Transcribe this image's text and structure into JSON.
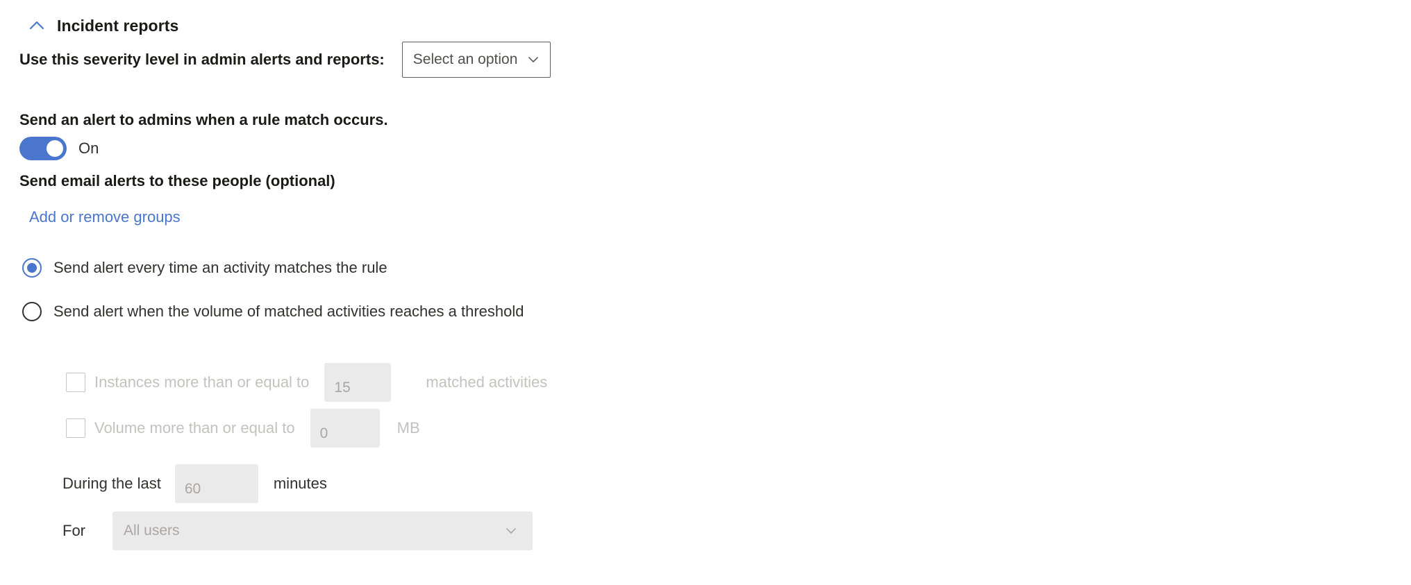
{
  "section": {
    "title": "Incident reports",
    "collapse_icon": "chevron-up-icon"
  },
  "severity": {
    "label": "Use this severity level in admin alerts and reports:",
    "dropdown_value": "Select an option",
    "dropdown_icon": "chevron-down-icon"
  },
  "admin_alert": {
    "label": "Send an alert to admins when a rule match occurs.",
    "toggle_state": "On"
  },
  "email_alerts": {
    "label": "Send email alerts to these people (optional)",
    "link_label": "Add or remove groups"
  },
  "alert_mode": {
    "option_every_time": "Send alert every time an activity matches the rule",
    "option_threshold": "Send alert when the volume of matched activities reaches a threshold"
  },
  "threshold": {
    "instances_label": "Instances more than or equal to",
    "instances_value": "15",
    "instances_suffix": "matched activities",
    "volume_label": "Volume more than or equal to",
    "volume_value": "0",
    "volume_suffix": "MB",
    "duration_label": "During the last",
    "duration_value": "60",
    "duration_suffix": "minutes",
    "for_label": "For",
    "for_value": "All users",
    "for_icon": "chevron-down-icon"
  },
  "colors": {
    "accent_blue": "#4a76ce",
    "text_primary": "#323130",
    "text_heading": "#1b1a19",
    "disabled_text": "#c3c2c0",
    "disabled_field_bg": "#ebeaea",
    "field_border": "#605e5c"
  }
}
